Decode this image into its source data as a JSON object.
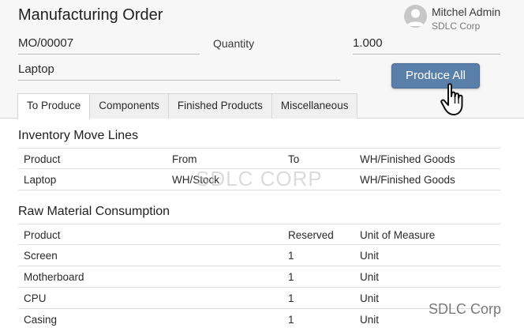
{
  "header": {
    "title": "Manufacturing Order",
    "user": {
      "name": "Mitchel Admin",
      "company": "SDLC Corp",
      "avatar_icon": "user-avatar-icon"
    }
  },
  "form": {
    "reference": "MO/00007",
    "quantity_label": "Quantity",
    "quantity_value": "1.000",
    "product": "Laptop",
    "produce_button_label": "Produce All",
    "pointer_icon": "hand-pointer-icon"
  },
  "tabs": [
    {
      "label": "To Produce",
      "active": true
    },
    {
      "label": "Components",
      "active": false
    },
    {
      "label": "Finished Products",
      "active": false
    },
    {
      "label": "Miscellaneous",
      "active": false
    }
  ],
  "inventory_move_lines": {
    "title": "Inventory Move Lines",
    "columns": [
      "Product",
      "From",
      "To",
      "WH/Finished Goods"
    ],
    "rows": [
      [
        "Laptop",
        "WH/Stock",
        "",
        "WH/Finished Goods"
      ]
    ]
  },
  "raw_material_consumption": {
    "title": "Raw Material Consumption",
    "columns": [
      "Product",
      "",
      "Reserved",
      "Unit of Measure"
    ],
    "rows": [
      [
        "Screen",
        "",
        "1",
        "Unit"
      ],
      [
        "Motherboard",
        "",
        "1",
        "Unit"
      ],
      [
        "CPU",
        "",
        "1",
        "Unit"
      ],
      [
        "Casing",
        "",
        "1",
        "Unit"
      ]
    ]
  },
  "watermark": "SDLC CORP",
  "brand_mark": "SDLC Corp",
  "colors": {
    "button": "#5a7fa8",
    "background": "#f7f7f7",
    "border": "#d6d6d6"
  }
}
